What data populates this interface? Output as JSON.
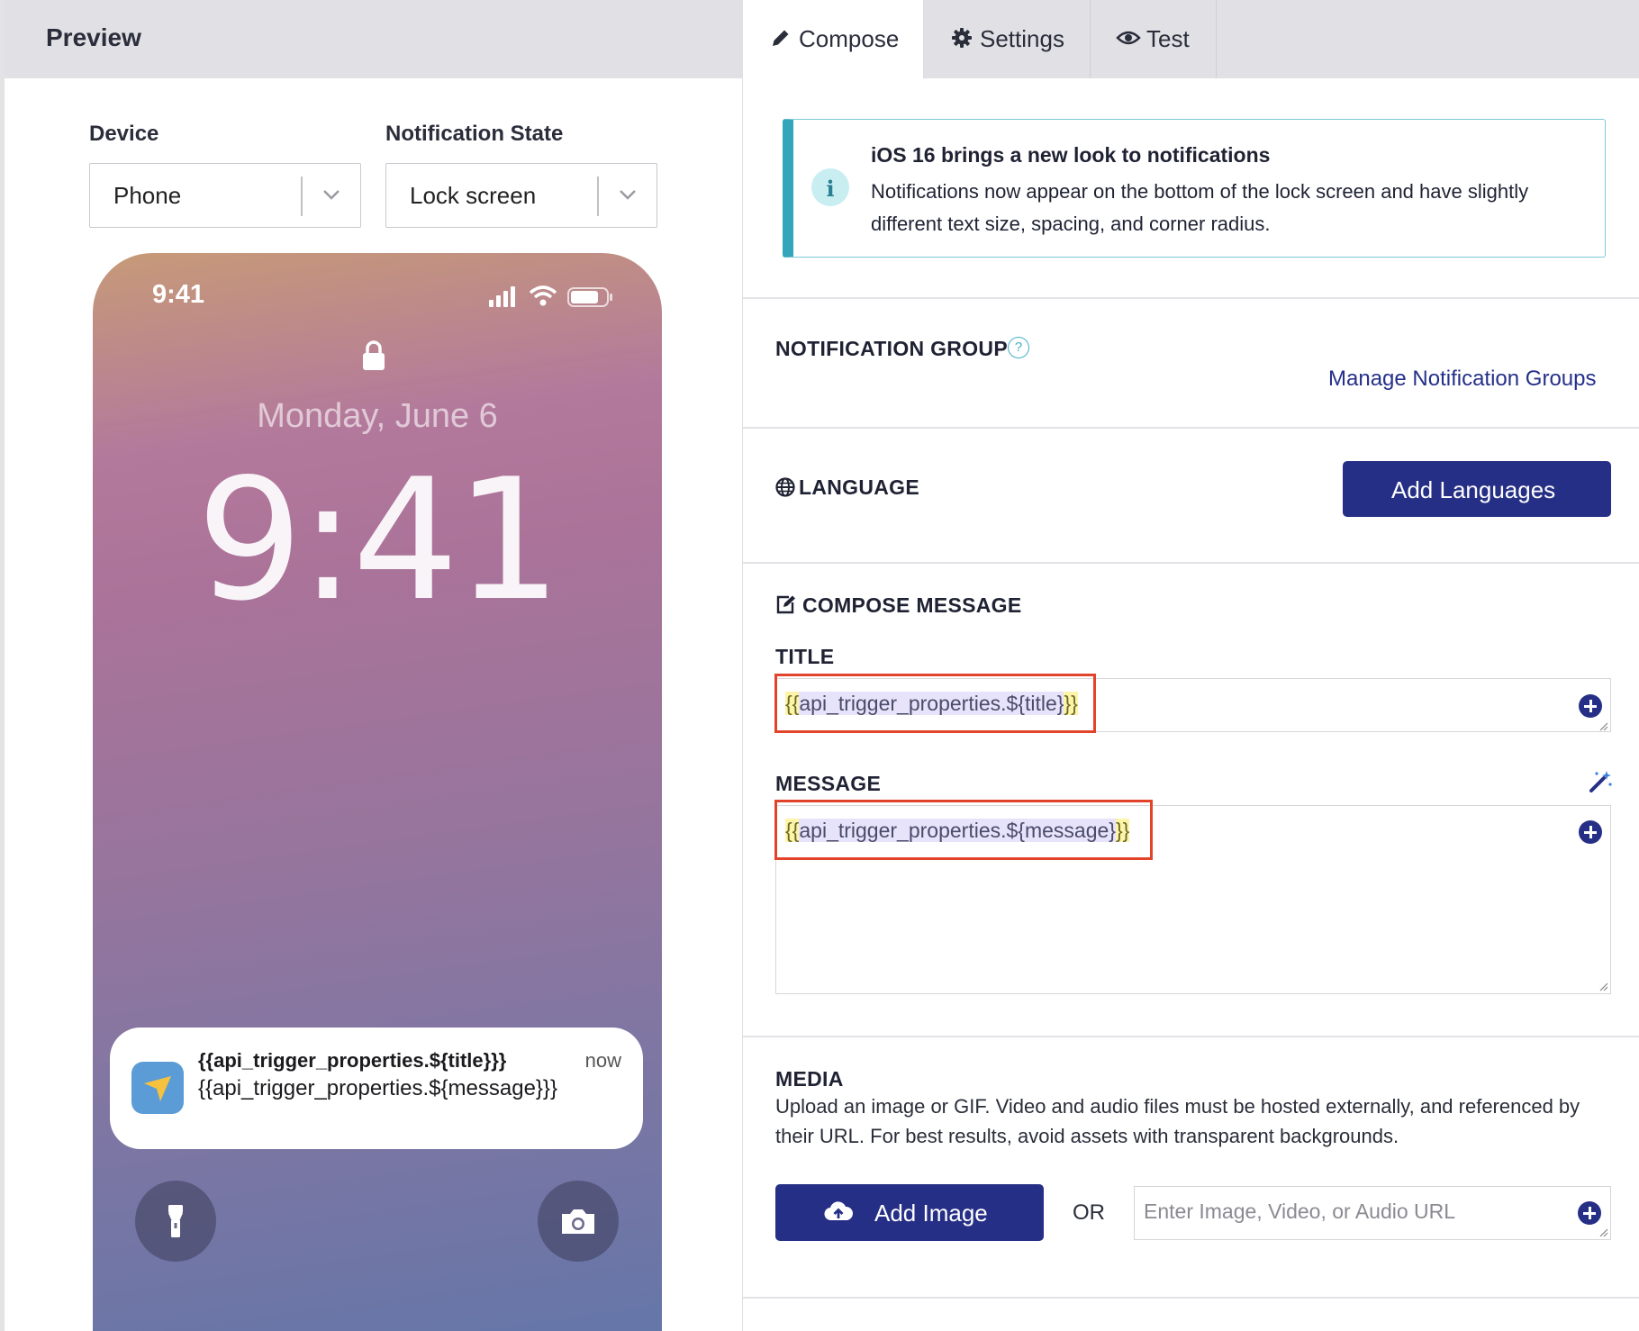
{
  "preview": {
    "header_title": "Preview",
    "device_label": "Device",
    "device_value": "Phone",
    "state_label": "Notification State",
    "state_value": "Lock screen",
    "phone": {
      "status_time": "9:41",
      "date": "Monday, June 6",
      "clock": "9:41",
      "notification": {
        "title": "{{api_trigger_properties.${title}}}",
        "time": "now",
        "message": "{{api_trigger_properties.${message}}}"
      }
    }
  },
  "tabs": [
    {
      "label": "Compose",
      "icon": "pencil-icon",
      "active": true
    },
    {
      "label": "Settings",
      "icon": "gear-icon",
      "active": false
    },
    {
      "label": "Test",
      "icon": "eye-icon",
      "active": false
    }
  ],
  "info": {
    "heading": "iOS 16 brings a new look to notifications",
    "body": "Notifications now appear on the bottom of the lock screen and have slightly different text size, spacing, and corner radius."
  },
  "notification_group": {
    "label": "NOTIFICATION GROUP",
    "help": "?",
    "link": "Manage Notification Groups"
  },
  "language": {
    "label": "LANGUAGE",
    "button": "Add Languages"
  },
  "compose": {
    "label": "COMPOSE MESSAGE",
    "title_label": "TITLE",
    "title_value": {
      "open": "{{",
      "token": "api_trigger_properties.${title}",
      "close": "}}"
    },
    "message_label": "MESSAGE",
    "message_value": {
      "open": "{{",
      "token": "api_trigger_properties.${message}",
      "close": "}}"
    }
  },
  "media": {
    "label": "MEDIA",
    "description": "Upload an image or GIF. Video and audio files must be hosted externally, and referenced by their URL. For best results, avoid assets with transparent backgrounds.",
    "button": "Add Image",
    "or": "OR",
    "url_placeholder": "Enter Image, Video, or Audio URL"
  },
  "colors": {
    "primary": "#262f86",
    "info_accent": "#33a6bb",
    "highlight_outline": "#e2442b"
  }
}
